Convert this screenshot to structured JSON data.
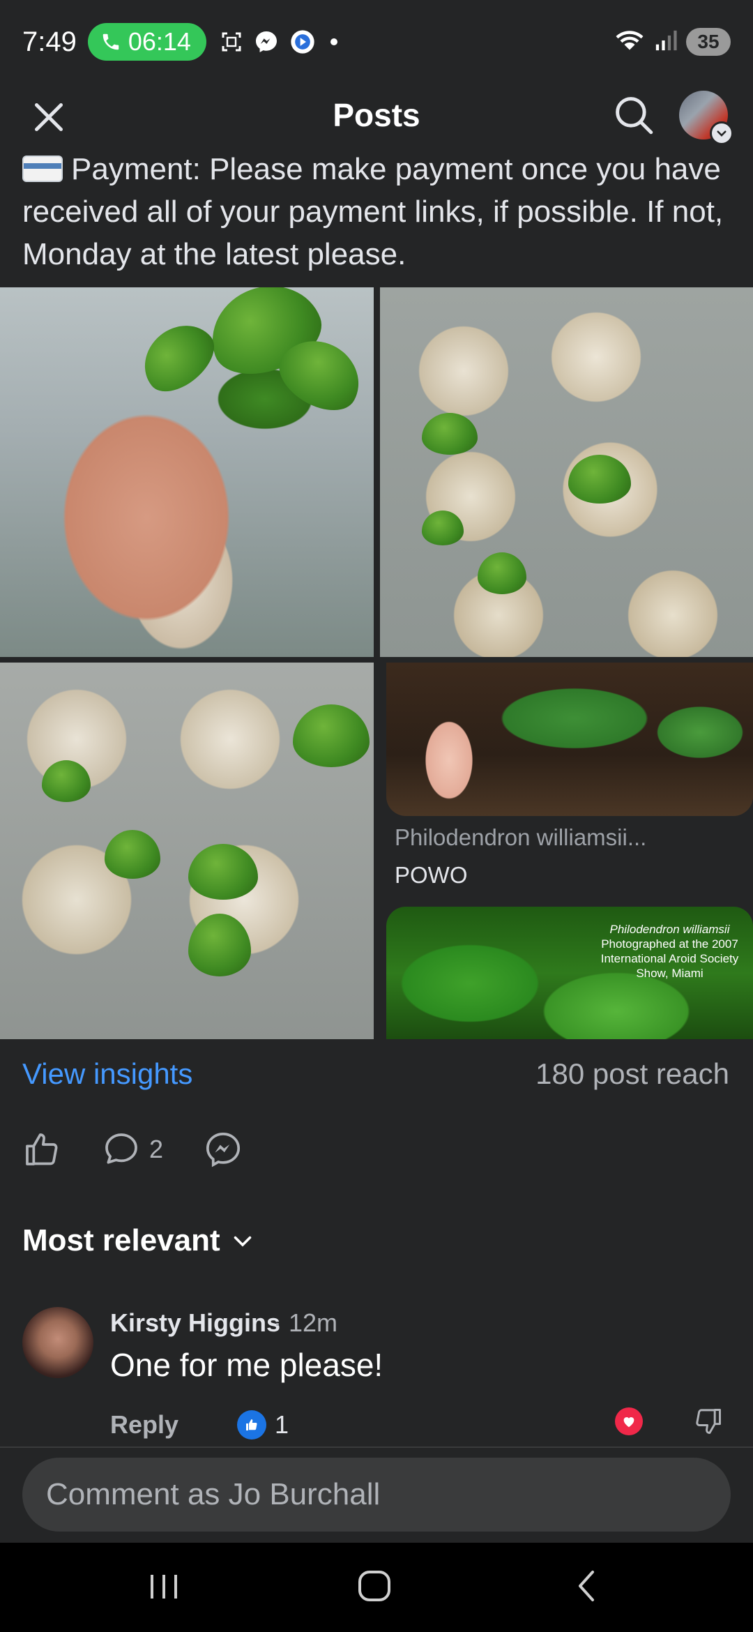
{
  "status_bar": {
    "time": "7:49",
    "call_timer": "06:14",
    "battery": "35"
  },
  "header": {
    "title": "Posts"
  },
  "post": {
    "text": "Payment: Please make payment once you have received all of your payment links, if possible. If not, Monday at the latest please."
  },
  "link_preview": {
    "title": "Philodendron williamsii...",
    "source": "POWO",
    "image_caption_line1": "Philodendron williamsii",
    "image_caption_line2": "Photographed at the 2007",
    "image_caption_line3": "International Aroid Society",
    "image_caption_line4": "Show, Miami"
  },
  "insights": {
    "view_label": "View insights",
    "reach": "180 post reach"
  },
  "actions": {
    "comment_count": "2"
  },
  "sort": {
    "label": "Most relevant"
  },
  "comment": {
    "author": "Kirsty Higgins",
    "time": "· 12m",
    "text": "One for me please!",
    "reply_label": "Reply",
    "like_count": "1"
  },
  "composer": {
    "placeholder": "Comment as Jo Burchall"
  },
  "colors": {
    "background": "#242526",
    "link_blue": "#4599ff",
    "call_green": "#34c759",
    "like_blue": "#1b74e4",
    "heart_red": "#f02849"
  }
}
